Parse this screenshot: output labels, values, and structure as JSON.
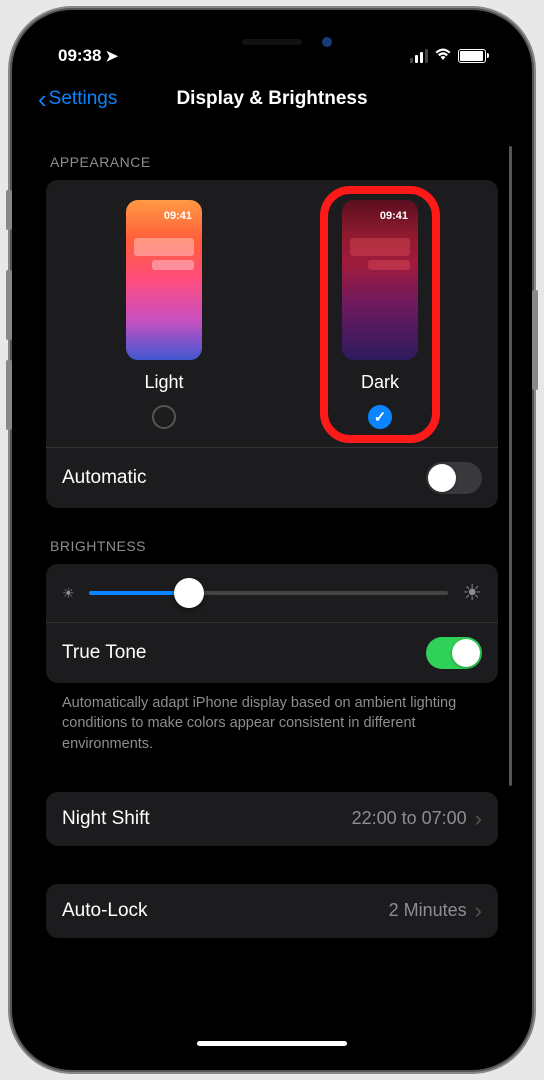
{
  "status": {
    "time": "09:38"
  },
  "nav": {
    "back_label": "Settings",
    "title": "Display & Brightness"
  },
  "appearance": {
    "header": "APPEARANCE",
    "thumb_time": "09:41",
    "light_label": "Light",
    "dark_label": "Dark",
    "selected": "dark",
    "automatic_label": "Automatic",
    "automatic_on": false
  },
  "brightness": {
    "header": "BRIGHTNESS",
    "value_percent": 28,
    "true_tone_label": "True Tone",
    "true_tone_on": true,
    "footer": "Automatically adapt iPhone display based on ambient lighting conditions to make colors appear consistent in different environments."
  },
  "night_shift": {
    "label": "Night Shift",
    "value": "22:00 to 07:00"
  },
  "auto_lock": {
    "label": "Auto-Lock",
    "value": "2 Minutes"
  }
}
